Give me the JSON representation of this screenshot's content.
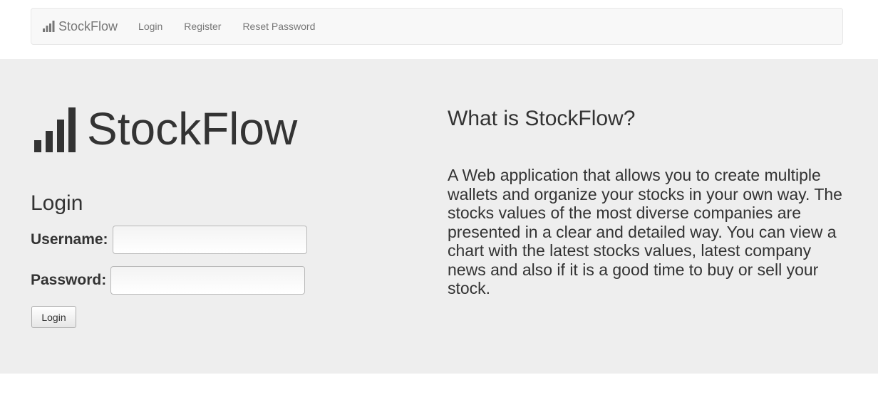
{
  "navbar": {
    "brand": "StockFlow",
    "brand_icon": "signal-bars-icon",
    "links": [
      "Login",
      "Register",
      "Reset Password"
    ]
  },
  "hero": {
    "logo_text": "StockFlow",
    "logo_icon": "signal-bars-icon"
  },
  "login_form": {
    "heading": "Login",
    "username_label": "Username:",
    "username_value": "",
    "password_label": "Password:",
    "password_value": "",
    "submit_label": "Login"
  },
  "info": {
    "title": "What is StockFlow?",
    "text": "A Web application that allows you to create multiple wallets and organize your stocks in your own way. The stocks values of the most diverse companies are presented in a clear and detailed way. You can view a chart with the latest stocks values, latest company news and also if it is a good time to buy or sell your stock."
  },
  "colors": {
    "navbar_bg": "#f8f8f8",
    "jumbotron_bg": "#eeeeee",
    "text": "#333333",
    "nav_link": "#777777"
  }
}
